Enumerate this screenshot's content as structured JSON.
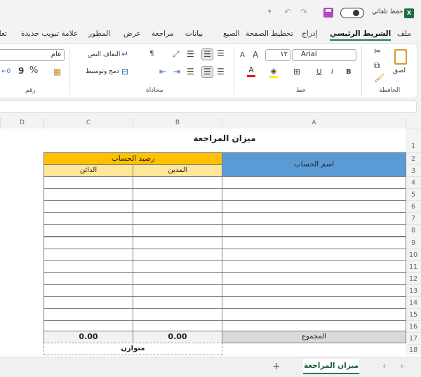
{
  "titlebar": {
    "autosave_label": "حفظ تلقائي",
    "app_icon": "excel-icon",
    "brand_color": "#1d6f42"
  },
  "tabs": [
    {
      "label": "ملف"
    },
    {
      "label": "الشريط الرئيسي",
      "active": true
    },
    {
      "label": "إدراج"
    },
    {
      "label": "تخطيط الصفحة"
    },
    {
      "label": "الصيغ"
    },
    {
      "label": "بيانات"
    },
    {
      "label": "مراجعة"
    },
    {
      "label": "عرض"
    },
    {
      "label": "المطور"
    },
    {
      "label": "علامة تبويب جديدة"
    },
    {
      "label": "تعل"
    }
  ],
  "ribbon": {
    "clipboard": {
      "label": "الحافظة",
      "paste": "لصق"
    },
    "font": {
      "label": "خط",
      "font_name": "Arial",
      "font_size": "١٢",
      "bold": "B",
      "italic": "I",
      "underline": "U",
      "grow": "A",
      "shrink": "A",
      "font_color": "#e81123",
      "fill_color": "#ffef00"
    },
    "alignment": {
      "label": "محاذاة",
      "wrap_text": "التفاف النص",
      "merge_center": "دمج وتوسيط"
    },
    "number": {
      "label": "رقم",
      "format": "عام",
      "percent": "%",
      "comma": "9"
    }
  },
  "sheet": {
    "columns": [
      "A",
      "B",
      "C",
      "D"
    ],
    "title": "ميزان المراجعة",
    "header_account": "اسم الحساب",
    "header_balance": "رصيد الحساب",
    "header_debit": "المدين",
    "header_credit": "الدائن",
    "total_label": "المجموع",
    "total_debit": "0.00",
    "total_credit": "0.00",
    "status": "متوازن",
    "rows": [
      "1",
      "2",
      "3",
      "4",
      "5",
      "6",
      "7",
      "8",
      "9",
      "10",
      "11",
      "12",
      "13",
      "14",
      "15",
      "16",
      "17",
      "18"
    ],
    "colors": {
      "account_header": "#5b9bd5",
      "balance_header": "#ffc000",
      "sub_header": "#ffe699",
      "total_row": "#d9d9d9"
    }
  },
  "sheet_tabs": {
    "active": "ميزان المراجعة",
    "add": "+",
    "prev": "‹",
    "next": "›"
  }
}
